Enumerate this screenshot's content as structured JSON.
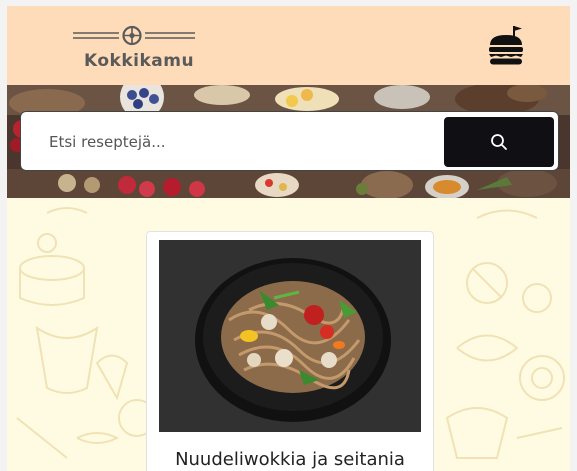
{
  "header": {
    "logo_text": "Kokkikamu",
    "menu_icon": "burger-icon"
  },
  "search": {
    "placeholder": "Etsi reseptejä...",
    "button_icon": "search-icon"
  },
  "recipes": [
    {
      "title": "Nuudeliwokkia ja seitania"
    }
  ],
  "colors": {
    "header_bg": "#ffdcb9",
    "main_bg": "#fffbe3",
    "search_button_bg": "#101014",
    "logo_text": "#5a5a5a"
  }
}
